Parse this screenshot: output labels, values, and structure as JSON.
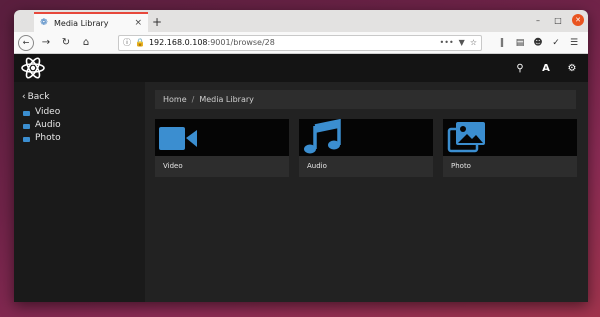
{
  "browser": {
    "tab_title": "Media Library",
    "tab_close": "×",
    "new_tab": "+",
    "url_host": "192.168.0.108",
    "url_path": ":9001/browse/28",
    "url_more": "•••"
  },
  "app": {
    "sidebar": {
      "back_label": "Back",
      "items": [
        {
          "label": "Video"
        },
        {
          "label": "Audio"
        },
        {
          "label": "Photo"
        }
      ]
    },
    "breadcrumb": {
      "home": "Home",
      "separator": "/",
      "current": "Media Library"
    },
    "cards": [
      {
        "label": "Video",
        "icon": "video-icon"
      },
      {
        "label": "Audio",
        "icon": "music-icon"
      },
      {
        "label": "Photo",
        "icon": "photos-icon"
      }
    ],
    "colors": {
      "accent": "#3b8ed0",
      "tab_accent": "#e7483b",
      "background": "#1e1e1e",
      "card": "#2d2d2d"
    },
    "header_icons": {
      "font_label": "A"
    }
  }
}
